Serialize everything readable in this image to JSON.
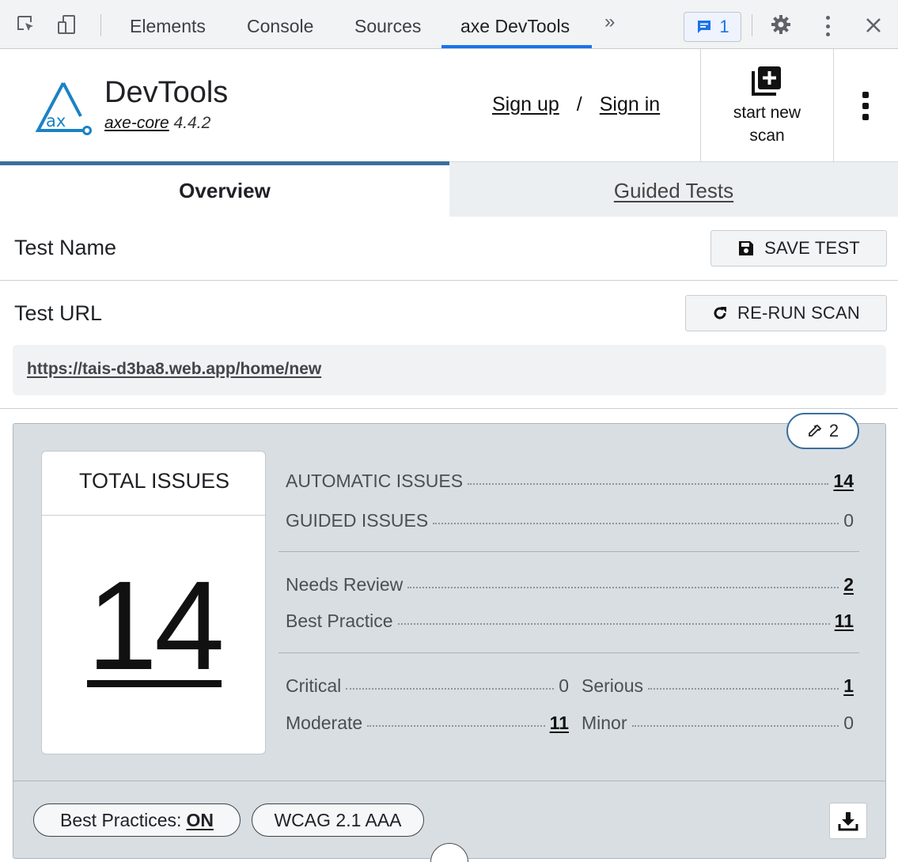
{
  "devtools": {
    "tabs": [
      "Elements",
      "Console",
      "Sources",
      "axe DevTools"
    ],
    "active_tab": "axe DevTools",
    "more_tabs": "»",
    "issues_count": "1"
  },
  "header": {
    "title": "DevTools",
    "engine_name": "axe-core",
    "engine_version": "4.4.2",
    "sign_up": "Sign up",
    "slash": "/",
    "sign_in": "Sign in",
    "start_new_scan": "start new scan"
  },
  "tabs": {
    "overview": "Overview",
    "guided": "Guided Tests"
  },
  "test": {
    "name_label": "Test Name",
    "save_label": "SAVE TEST",
    "url_label": "Test URL",
    "rerun_label": "RE-RUN SCAN",
    "url": "https://tais-d3ba8.web.app/home/new"
  },
  "summary": {
    "needs_review_pill": "2",
    "total_title": "TOTAL ISSUES",
    "total": "14",
    "automatic_label": "AUTOMATIC ISSUES",
    "automatic": "14",
    "guided_label": "GUIDED ISSUES",
    "guided": "0",
    "needs_review_label": "Needs Review",
    "needs_review": "2",
    "best_practice_label": "Best Practice",
    "best_practice": "11",
    "critical_label": "Critical",
    "critical": "0",
    "serious_label": "Serious",
    "serious": "1",
    "moderate_label": "Moderate",
    "moderate": "11",
    "minor_label": "Minor",
    "minor": "0"
  },
  "footer": {
    "best_practices_label": "Best Practices:",
    "best_practices_state": "ON",
    "standard": "WCAG 2.1 AAA"
  },
  "colors": {
    "accent": "#3a6f9f",
    "devtools_blue": "#1a73e8",
    "panel_bg": "#d8dee2"
  }
}
